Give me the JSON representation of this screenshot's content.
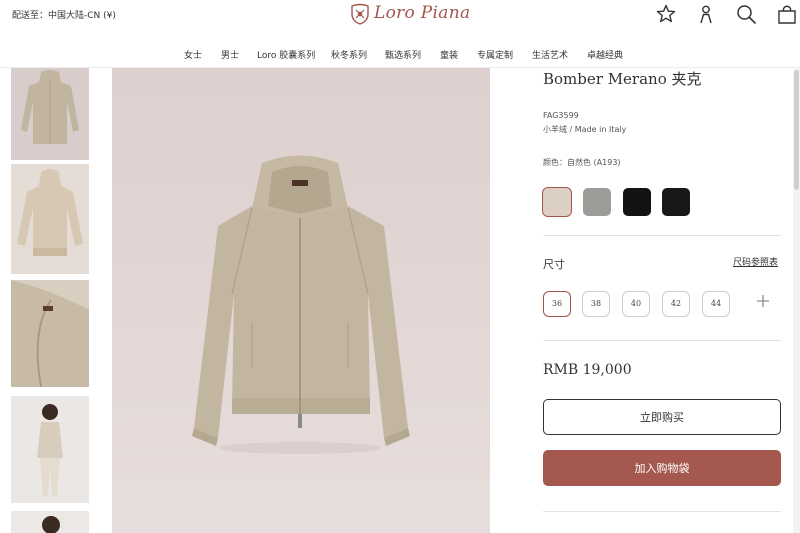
{
  "header": {
    "ship_to": "配送至：中国大陆-CN (¥)",
    "logo_text": "Loro Piana",
    "icons": [
      "star-icon",
      "user-icon",
      "search-icon",
      "bag-icon"
    ]
  },
  "nav": {
    "items": [
      "女士",
      "男士",
      "Loro 胶囊系列",
      "秋冬系列",
      "甄选系列",
      "童装",
      "专属定制",
      "生活艺术",
      "卓越经典"
    ]
  },
  "product": {
    "title": "Bomber Merano 夹克",
    "sku": "FAG3599",
    "material": "小羊绒 / Made in Italy",
    "color_label": "颜色：自然色 (A193)",
    "swatches": [
      {
        "color": "#dccfc4",
        "selected": true
      },
      {
        "color": "#9d9b98",
        "selected": false
      },
      {
        "color": "#121314",
        "selected": false
      },
      {
        "color": "#17181a",
        "selected": false
      }
    ],
    "size_label": "尺寸",
    "size_chart_link": "尺码参照表",
    "sizes": [
      "36",
      "38",
      "40",
      "42",
      "44"
    ],
    "selected_size": "36",
    "price": "RMB 19,000",
    "buy_now_label": "立即购买",
    "add_to_bag_label": "加入购物袋"
  },
  "colors": {
    "brand": "#a3554b",
    "add_to_bag_bg": "#a5584d",
    "image_bg": "#ded2d1",
    "knit": "#c1b49e"
  }
}
